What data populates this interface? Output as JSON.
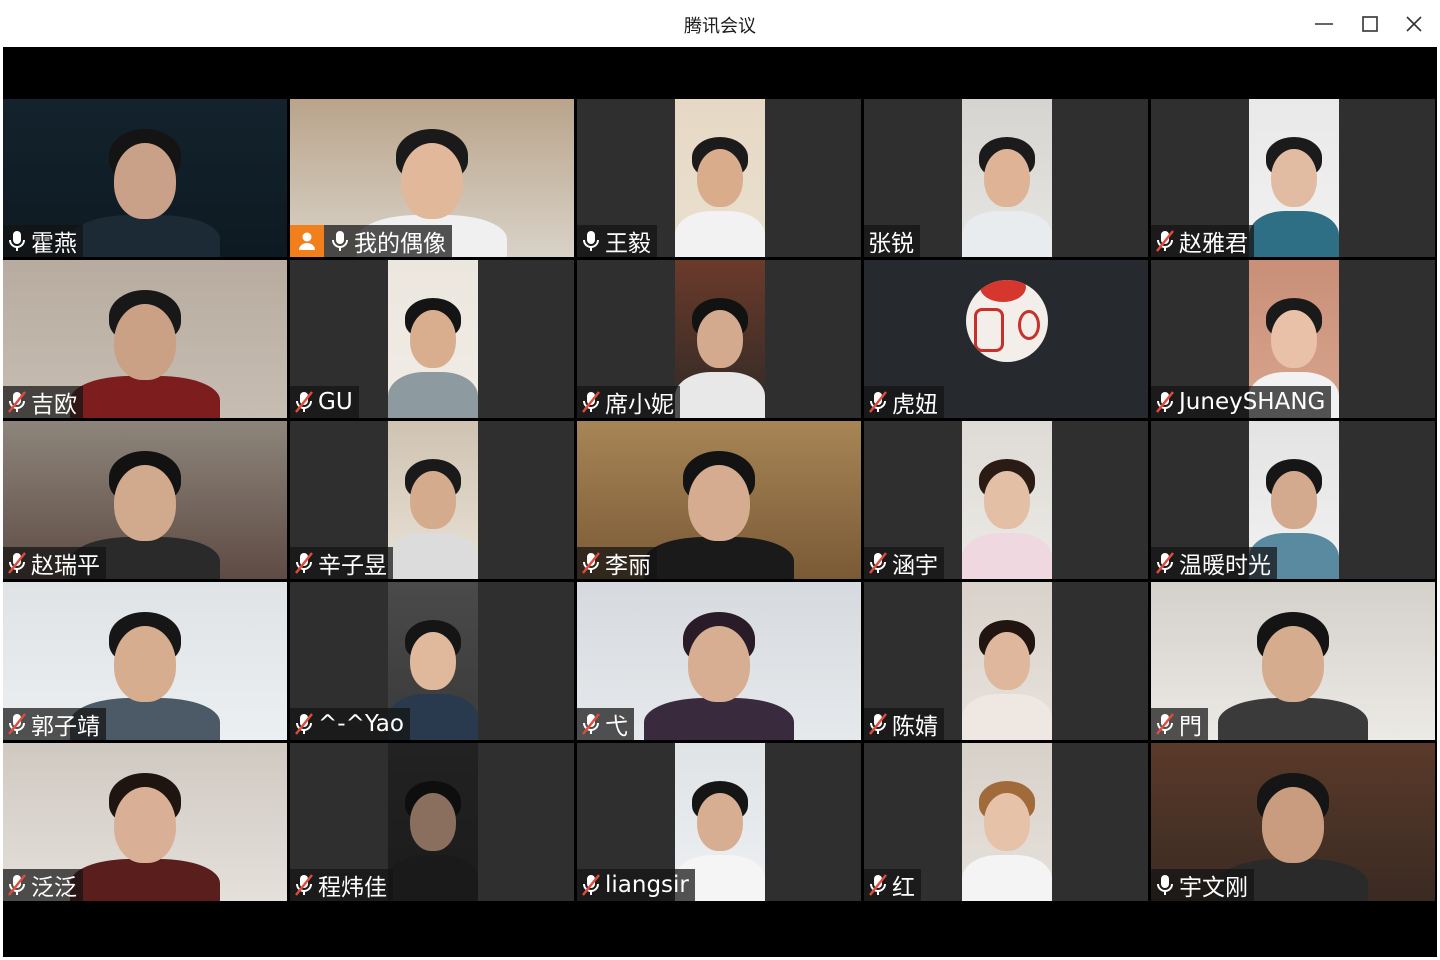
{
  "window": {
    "title": "腾讯会议",
    "controls": [
      "minimize-icon",
      "maximize-icon",
      "close-icon"
    ]
  },
  "colors": {
    "titlebar_bg": "#ffffff",
    "stage_bg": "#000000",
    "tile_bg": "#2f2f2f",
    "label_bg": "rgba(20,20,20,0.72)",
    "active_speaker_border": "#2fbf7b",
    "host_badge": "#f07f1c",
    "muted_mic": "#e24a3b"
  },
  "participants": [
    {
      "name": "霍燕",
      "mic": "on",
      "active": true,
      "host": false
    },
    {
      "name": "我的偶像",
      "mic": "on",
      "active": false,
      "host": true
    },
    {
      "name": "王毅",
      "mic": "on",
      "active": false,
      "host": false
    },
    {
      "name": "张锐",
      "mic": "none",
      "active": false,
      "host": false
    },
    {
      "name": "赵雅君",
      "mic": "muted",
      "active": false,
      "host": false
    },
    {
      "name": "吉欧",
      "mic": "muted",
      "active": false,
      "host": false
    },
    {
      "name": "GU",
      "mic": "muted",
      "active": false,
      "host": false
    },
    {
      "name": "席小妮",
      "mic": "muted",
      "active": false,
      "host": false
    },
    {
      "name": "虎妞",
      "mic": "muted",
      "active": false,
      "host": false,
      "avatar": true
    },
    {
      "name": "JuneySHANG",
      "mic": "muted",
      "active": false,
      "host": false
    },
    {
      "name": "赵瑞平",
      "mic": "muted",
      "active": false,
      "host": false
    },
    {
      "name": "辛子昱",
      "mic": "muted",
      "active": false,
      "host": false
    },
    {
      "name": "李丽",
      "mic": "muted",
      "active": false,
      "host": false
    },
    {
      "name": "涵宇",
      "mic": "muted",
      "active": false,
      "host": false
    },
    {
      "name": "温暖时光",
      "mic": "muted",
      "active": false,
      "host": false
    },
    {
      "name": "郭子靖",
      "mic": "muted",
      "active": false,
      "host": false
    },
    {
      "name": "^-^Yao",
      "mic": "muted",
      "active": false,
      "host": false
    },
    {
      "name": "弋",
      "mic": "muted",
      "active": false,
      "host": false
    },
    {
      "name": "陈婧",
      "mic": "muted",
      "active": false,
      "host": false
    },
    {
      "name": "門",
      "mic": "muted",
      "active": false,
      "host": false
    },
    {
      "name": "泛泛",
      "mic": "muted",
      "active": false,
      "host": false
    },
    {
      "name": "程炜佳",
      "mic": "muted",
      "active": false,
      "host": false
    },
    {
      "name": "liangsir",
      "mic": "muted",
      "active": false,
      "host": false
    },
    {
      "name": "红",
      "mic": "muted",
      "active": false,
      "host": false
    },
    {
      "name": "宇文刚",
      "mic": "on",
      "active": false,
      "host": false
    }
  ]
}
